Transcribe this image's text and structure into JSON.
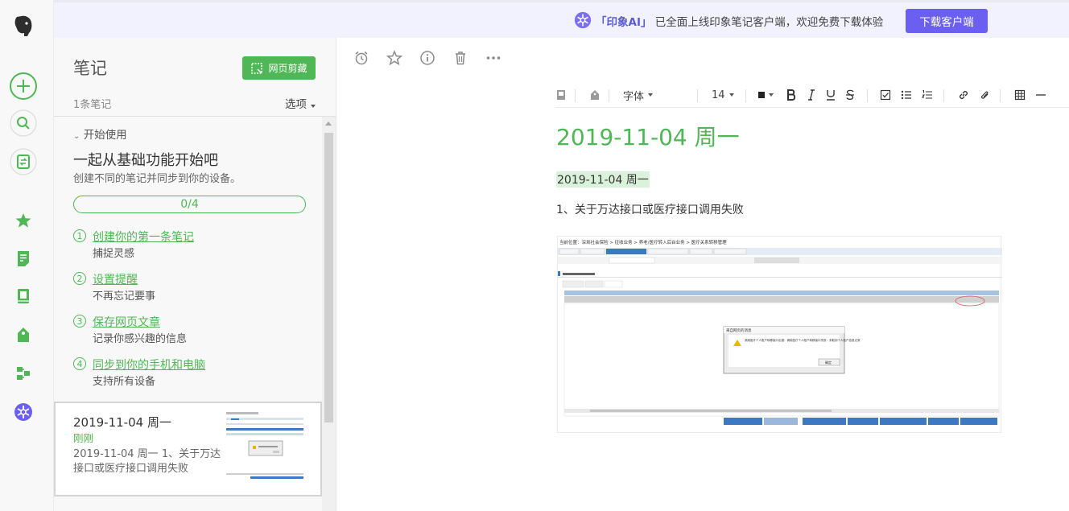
{
  "banner": {
    "ai_label": "「印象AI」",
    "message": "已全面上线印象笔记客户端，欢迎免费下载体验",
    "download_label": "下载客户端"
  },
  "sidebar": {
    "icons": [
      "elephant-logo-icon",
      "new-note-icon",
      "search-icon",
      "sync-icon",
      "star-icon",
      "notes-icon",
      "notebook-icon",
      "tag-icon",
      "workspace-icon",
      "ai-icon"
    ],
    "accent": "#4fb755"
  },
  "notes_panel": {
    "title": "笔记",
    "web_clip_label": "网页剪藏",
    "count": "1条笔记",
    "options_label": "选项",
    "getting_started": {
      "section": "开始使用",
      "title": "一起从基础功能开始吧",
      "desc": "创建不同的笔记并同步到你的设备。",
      "progress": "0/4",
      "tasks": [
        {
          "num": "1",
          "title": "创建你的第一条笔记",
          "sub": "捕捉灵感"
        },
        {
          "num": "2",
          "title": "设置提醒",
          "sub": "不再忘记要事"
        },
        {
          "num": "3",
          "title": "保存网页文章",
          "sub": "记录你感兴趣的信息"
        },
        {
          "num": "4",
          "title": "同步到你的手机和电脑",
          "sub": "支持所有设备"
        }
      ]
    },
    "note": {
      "title": "2019-11-04 周一",
      "time": "刚刚",
      "snippet": "2019-11-04 周一 1、关于万达接口或医疗接口调用失败"
    }
  },
  "toolbar": {
    "icons": [
      "alarm-icon",
      "star-icon",
      "info-icon",
      "trash-icon",
      "more-icon"
    ],
    "font_label": "字体",
    "font_size": "14"
  },
  "document": {
    "title": "2019-11-04 周一",
    "line1": "2019-11-04 周一",
    "line2": "1、关于万达接口或医疗接口调用失败"
  },
  "screenshot": {
    "breadcrumb": "当前位置：深圳社会保险 > 征收业务 > 养老/医疗转入后台业务 > 医疗关系转移管理",
    "dialog_title": "来自网页的消息",
    "dialog_msg": "调用医疗个人账户转移接口出错：调用医疗个人账户转移接口失败：未取到个人账户信息记录",
    "dialog_ok": "确定"
  }
}
